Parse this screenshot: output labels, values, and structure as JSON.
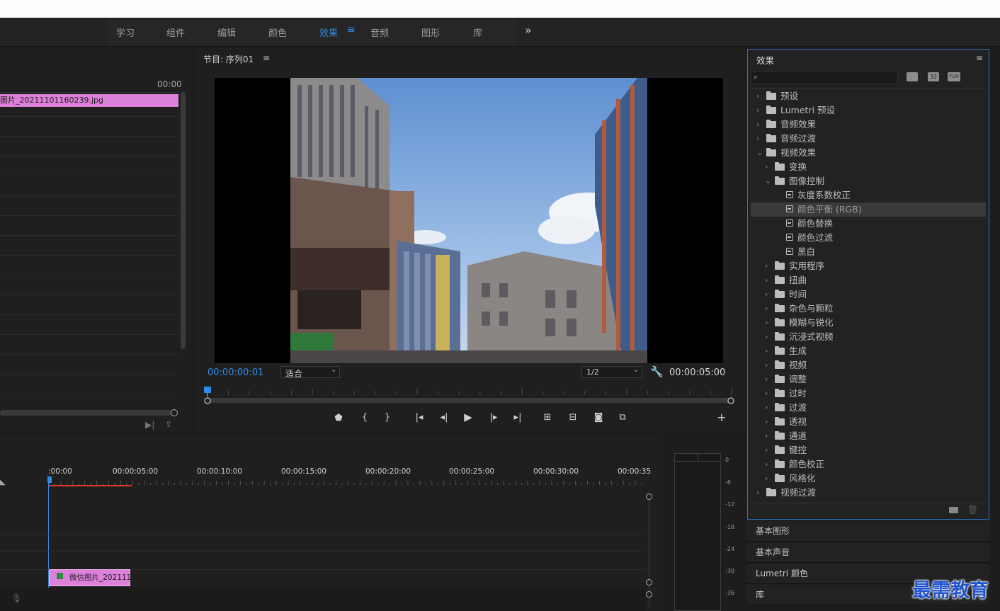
{
  "workspace_tabs": [
    "学习",
    "组件",
    "编辑",
    "颜色",
    "效果",
    "音频",
    "图形",
    "库"
  ],
  "workspace_active": "效果",
  "workspace_more": "»",
  "source": {
    "timecode": "00:00",
    "clip_label": "图片_20211101160239.jpg"
  },
  "program": {
    "title": "节目: 序列01",
    "menu_icon": "≡",
    "current_time": "00:00:00:01",
    "fit_label": "适合",
    "resolution": "1/2",
    "duration": "00:00:05:00",
    "playhead_fraction": 0.0
  },
  "effects": {
    "title": "效果",
    "search_placeholder": "",
    "badges": [
      "32",
      "YUV"
    ],
    "tree": [
      {
        "label": "预设",
        "level": 0,
        "type": "folder-star",
        "expanded": false
      },
      {
        "label": "Lumetri 预设",
        "level": 0,
        "type": "folder-star",
        "expanded": false
      },
      {
        "label": "音频效果",
        "level": 0,
        "type": "folder",
        "expanded": false
      },
      {
        "label": "音频过渡",
        "level": 0,
        "type": "folder",
        "expanded": false
      },
      {
        "label": "视频效果",
        "level": 0,
        "type": "folder",
        "expanded": true
      },
      {
        "label": "变换",
        "level": 1,
        "type": "folder",
        "expanded": false
      },
      {
        "label": "图像控制",
        "level": 1,
        "type": "folder",
        "expanded": true
      },
      {
        "label": "灰度系数校正",
        "level": 2,
        "type": "effect"
      },
      {
        "label": "颜色平衡 (RGB)",
        "level": 2,
        "type": "effect",
        "selected": true
      },
      {
        "label": "颜色替换",
        "level": 2,
        "type": "effect"
      },
      {
        "label": "颜色过滤",
        "level": 2,
        "type": "effect"
      },
      {
        "label": "黑白",
        "level": 2,
        "type": "effect"
      },
      {
        "label": "实用程序",
        "level": 1,
        "type": "folder",
        "expanded": false
      },
      {
        "label": "扭曲",
        "level": 1,
        "type": "folder",
        "expanded": false
      },
      {
        "label": "时间",
        "level": 1,
        "type": "folder",
        "expanded": false
      },
      {
        "label": "杂色与颗粒",
        "level": 1,
        "type": "folder",
        "expanded": false
      },
      {
        "label": "模糊与锐化",
        "level": 1,
        "type": "folder",
        "expanded": false
      },
      {
        "label": "沉浸式视频",
        "level": 1,
        "type": "folder",
        "expanded": false
      },
      {
        "label": "生成",
        "level": 1,
        "type": "folder",
        "expanded": false
      },
      {
        "label": "视频",
        "level": 1,
        "type": "folder",
        "expanded": false
      },
      {
        "label": "调整",
        "level": 1,
        "type": "folder",
        "expanded": false
      },
      {
        "label": "过时",
        "level": 1,
        "type": "folder",
        "expanded": false
      },
      {
        "label": "过渡",
        "level": 1,
        "type": "folder",
        "expanded": false
      },
      {
        "label": "透视",
        "level": 1,
        "type": "folder",
        "expanded": false
      },
      {
        "label": "通道",
        "level": 1,
        "type": "folder",
        "expanded": false
      },
      {
        "label": "键控",
        "level": 1,
        "type": "folder",
        "expanded": false
      },
      {
        "label": "颜色校正",
        "level": 1,
        "type": "folder",
        "expanded": false
      },
      {
        "label": "风格化",
        "level": 1,
        "type": "folder",
        "expanded": false
      },
      {
        "label": "视频过渡",
        "level": 0,
        "type": "folder",
        "expanded": false
      }
    ]
  },
  "collapsed_panels": [
    "基本图形",
    "基本声音",
    "Lumetri 颜色",
    "库"
  ],
  "timeline": {
    "ruler_labels": [
      ":00:00",
      "00:00:05:00",
      "00:00:10:00",
      "00:00:15:00",
      "00:00:20:00",
      "00:00:25:00",
      "00:00:30:00",
      "00:00:35"
    ],
    "clip_label": "微信图片_202111"
  },
  "meter_labels": [
    "0",
    "-6",
    "-12",
    "-18",
    "-24",
    "-30",
    "-36"
  ],
  "watermark": "最需教育",
  "colors": {
    "accent": "#2d8ceb",
    "clip_pink": "#dd80d9",
    "selection_border": "#2d73c4",
    "inout_red": "#e0352b"
  }
}
